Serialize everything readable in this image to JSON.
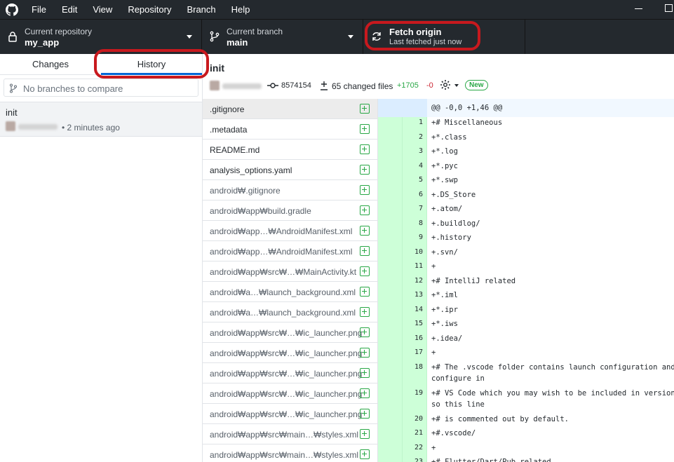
{
  "menu": [
    "File",
    "Edit",
    "View",
    "Repository",
    "Branch",
    "Help"
  ],
  "toolbar": {
    "repo": {
      "label": "Current repository",
      "value": "my_app"
    },
    "branch": {
      "label": "Current branch",
      "value": "main"
    },
    "fetch": {
      "label": "Fetch origin",
      "sub": "Last fetched just now"
    }
  },
  "sidebar": {
    "tabs": [
      "Changes",
      "History"
    ],
    "active_tab": "History",
    "compare_placeholder": "No branches to compare",
    "commit": {
      "title": "init",
      "time": "• 2 minutes ago"
    }
  },
  "commit": {
    "title": "init",
    "sha": "8574154",
    "files_changed": "65 changed files",
    "additions": "+1705",
    "deletions": "-0",
    "badge": "New"
  },
  "files": [
    ".gitignore",
    ".metadata",
    "README.md",
    "analysis_options.yaml",
    "android₩.gitignore",
    "android₩app₩build.gradle",
    "android₩app…₩AndroidManifest.xml",
    "android₩app…₩AndroidManifest.xml",
    "android₩app₩src₩…₩MainActivity.kt",
    "android₩a…₩launch_background.xml",
    "android₩a…₩launch_background.xml",
    "android₩app₩src₩…₩ic_launcher.png",
    "android₩app₩src₩…₩ic_launcher.png",
    "android₩app₩src₩…₩ic_launcher.png",
    "android₩app₩src₩…₩ic_launcher.png",
    "android₩app₩src₩…₩ic_launcher.png",
    "android₩app₩src₩main…₩styles.xml",
    "android₩app₩src₩main…₩styles.xml"
  ],
  "diff": {
    "hunk": "@@ -0,0 +1,46 @@",
    "lines": [
      {
        "n": "1",
        "text": "+# Miscellaneous"
      },
      {
        "n": "2",
        "text": "+*.class"
      },
      {
        "n": "3",
        "text": "+*.log"
      },
      {
        "n": "4",
        "text": "+*.pyc"
      },
      {
        "n": "5",
        "text": "+*.swp"
      },
      {
        "n": "6",
        "text": "+.DS_Store"
      },
      {
        "n": "7",
        "text": "+.atom/"
      },
      {
        "n": "8",
        "text": "+.buildlog/"
      },
      {
        "n": "9",
        "text": "+.history"
      },
      {
        "n": "10",
        "text": "+.svn/"
      },
      {
        "n": "11",
        "text": "+"
      },
      {
        "n": "12",
        "text": "+# IntelliJ related"
      },
      {
        "n": "13",
        "text": "+*.iml"
      },
      {
        "n": "14",
        "text": "+*.ipr"
      },
      {
        "n": "15",
        "text": "+*.iws"
      },
      {
        "n": "16",
        "text": "+.idea/"
      },
      {
        "n": "17",
        "text": "+"
      },
      {
        "n": "18",
        "text": "+# The .vscode folder contains launch configuration and ta\nconfigure in"
      },
      {
        "n": "19",
        "text": "+# VS Code which you may wish to be included in version co\nso this line"
      },
      {
        "n": "20",
        "text": "+# is commented out by default."
      },
      {
        "n": "21",
        "text": "+#.vscode/"
      },
      {
        "n": "22",
        "text": "+"
      },
      {
        "n": "23",
        "text": "+# Flutter/Dart/Pub related"
      }
    ]
  },
  "colors": {
    "accent": "#0366d6",
    "added": "#28a745",
    "deleted": "#cb2431",
    "highlight_ring": "#c8191e"
  }
}
